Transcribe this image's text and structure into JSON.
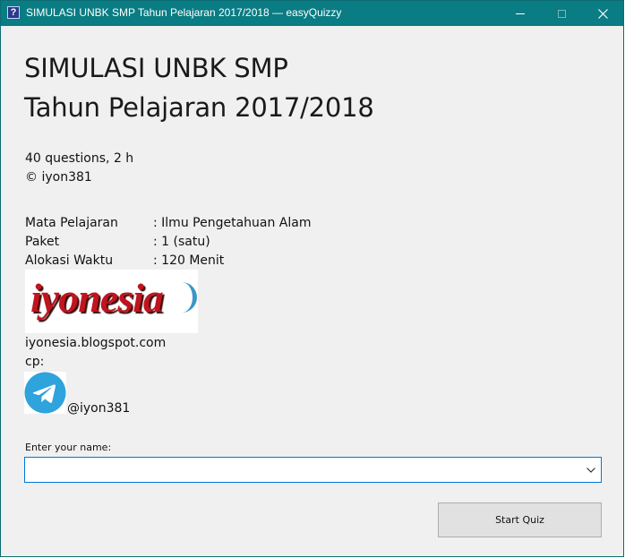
{
  "window": {
    "title": "SIMULASI UNBK SMP Tahun Pelajaran 2017/2018 — easyQuizzy",
    "app_icon_glyph": "?",
    "controls": [
      "minimize-icon",
      "maximize-icon",
      "close-icon"
    ],
    "colors": {
      "titlebar": "#0a7c83",
      "window_bg": "#f0f0f0",
      "focus_border": "#0078d7"
    }
  },
  "header": {
    "title_line1": "SIMULASI UNBK SMP",
    "title_line2": "Tahun Pelajaran 2017/2018"
  },
  "summary": {
    "questions": "40 questions, 2 h",
    "copyright": "© iyon381"
  },
  "details": [
    {
      "label": "Mata Pelajaran",
      "value": ": Ilmu Pengetahuan Alam"
    },
    {
      "label": "Paket",
      "value": ": 1 (satu)"
    },
    {
      "label": "Alokasi Waktu",
      "value": ": 120 Menit"
    }
  ],
  "logo": {
    "text": "iyonesia",
    "colors": {
      "text": "#c0141e",
      "swoosh": "#3a97c8"
    }
  },
  "contact": {
    "blog": "iyonesia.blogspot.com",
    "cp_label": "cp:",
    "telegram_icon": "telegram-icon",
    "telegram_handle": "@iyon381"
  },
  "form": {
    "name_label": "Enter your name:",
    "name_value": "",
    "start_button": "Start Quiz"
  }
}
